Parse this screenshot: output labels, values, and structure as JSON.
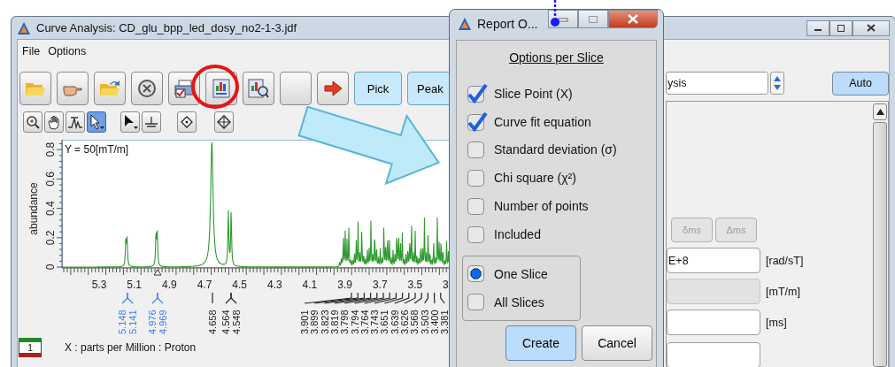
{
  "window": {
    "title": "Curve Analysis: CD_glu_bpp_led_dosy_no2-1-3.jdf"
  },
  "menu": [
    "File",
    "Options"
  ],
  "mode_buttons": [
    "Pick",
    "Peak"
  ],
  "view_tools": [
    {
      "selected": false
    },
    {
      "selected": false
    },
    {
      "selected": false
    },
    {
      "selected": true
    },
    {
      "selected": false
    },
    {
      "selected": false
    },
    {
      "selected": false
    },
    {
      "selected": false
    }
  ],
  "plot": {
    "annotation": "Y = 50[mT/m]",
    "y_label": "abundance",
    "y_ticks": [
      "0",
      "0.2",
      "0.4",
      "0.6",
      "0.8"
    ],
    "x_ticks": [
      "5.3",
      "5.1",
      "4.9",
      "4.7",
      "4.5",
      "4.3",
      "4.1",
      "3.9",
      "3.7",
      "3.5",
      "3"
    ],
    "x_label": "X : parts per Million : Proton",
    "peak_labels": [
      {
        "text": "5.148",
        "color": "#3a7bff"
      },
      {
        "text": "5.141",
        "color": "#3a7bff"
      },
      {
        "text": "4.976",
        "color": "#3a7bff"
      },
      {
        "text": "4.969",
        "color": "#3a7bff"
      },
      {
        "text": "4.658",
        "color": "#222222"
      },
      {
        "text": "4.564",
        "color": "#222222"
      },
      {
        "text": "4.548",
        "color": "#222222"
      },
      {
        "text": "3.901",
        "color": "#222222"
      },
      {
        "text": "3.899",
        "color": "#222222"
      },
      {
        "text": "3.823",
        "color": "#222222"
      },
      {
        "text": "3.819",
        "color": "#222222"
      },
      {
        "text": "3.798",
        "color": "#222222"
      },
      {
        "text": "3.794",
        "color": "#222222"
      },
      {
        "text": "3.764",
        "color": "#222222"
      },
      {
        "text": "3.743",
        "color": "#222222"
      },
      {
        "text": "3.651",
        "color": "#222222"
      },
      {
        "text": "3.639",
        "color": "#222222"
      },
      {
        "text": "3.626",
        "color": "#222222"
      },
      {
        "text": "3.568",
        "color": "#222222"
      },
      {
        "text": "3.503",
        "color": "#222222"
      },
      {
        "text": "3.400",
        "color": "#222222"
      },
      {
        "text": "3.381",
        "color": "#222222"
      }
    ]
  },
  "trace_selector": "1",
  "dialog": {
    "title": "Report O...",
    "heading": "Options per Slice",
    "options": [
      {
        "label": "Slice Point (X)",
        "checked": true
      },
      {
        "label": "Curve fit equation",
        "checked": true
      },
      {
        "label": "Standard deviation (σ)",
        "checked": false
      },
      {
        "label": "Chi square (χ²)",
        "checked": false
      },
      {
        "label": "Number of points",
        "checked": false
      },
      {
        "label": "Included",
        "checked": false
      }
    ],
    "scope": [
      {
        "label": "One Slice",
        "selected": true
      },
      {
        "label": "All Slices",
        "selected": false
      }
    ],
    "buttons": [
      {
        "label": "Create",
        "default": true
      },
      {
        "label": "Cancel",
        "default": false
      }
    ]
  },
  "right_panel": {
    "dropdown_value": "ysis",
    "auto_button": "Auto",
    "buttons": [
      {
        "label": "δms",
        "disabled": true
      },
      {
        "label": "Δms",
        "disabled": true
      }
    ],
    "fields": [
      {
        "value": "E+8",
        "unit": "[rad/sT]",
        "disabled": false
      },
      {
        "unit": "[mT/m]",
        "disabled": true
      },
      {
        "unit": "[ms]",
        "disabled": false
      }
    ]
  }
}
